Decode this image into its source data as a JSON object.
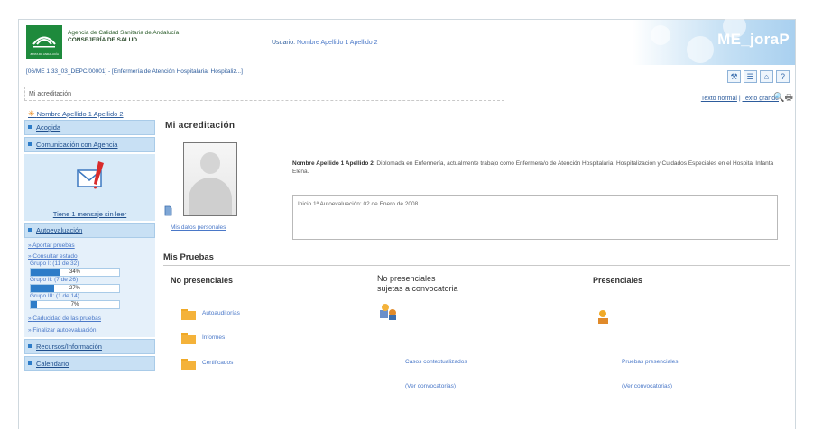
{
  "header": {
    "org_line1": "Agencia de Calidad Sanitaria de Andalucía",
    "org_line2": "CONSEJERÍA DE SALUD",
    "logo_caption": "JUNTA DE ANDALUCÍA",
    "user_prefix": "Usuario:",
    "user_name": "Nombre Apellido 1 Apellido 2",
    "brand": "ME_joraP",
    "breadcrumb": "[06/ME 1 33_03_DEPC/00001] - [Enfermería de Atención Hospitalaria: Hospitaliz...]"
  },
  "toolbar": {
    "icons": [
      "tools-icon",
      "list-icon",
      "home-icon",
      "question-icon"
    ],
    "icon_glyphs": [
      "⚒",
      "☰",
      "⌂",
      "?"
    ]
  },
  "location_field": "Mi acreditación",
  "text_size": {
    "normal": "Texto normal",
    "separator": "|",
    "large": "Texto grande"
  },
  "sidebar": {
    "user_name": "Nombre Apellido 1 Apellido 2",
    "nav": {
      "acogida": "Acogida",
      "comunicacion": "Comunicación con Agencia",
      "autoevaluacion": "Autoevaluación",
      "recursos": "Recursos/Información",
      "calendario": "Calendario"
    },
    "message": "Tiene 1 mensaje sin leer",
    "links": {
      "aportar": "Aportar pruebas",
      "consultar": "Consultar estado",
      "caducidad": "Caducidad de las pruebas",
      "finalizar": "Finalizar autoevaluación"
    },
    "groups": [
      {
        "label": "Grupo I: (11 de 32)",
        "percent_text": "34%",
        "fraction": 0.34
      },
      {
        "label": "Grupo II: (7 de 26)",
        "percent_text": "27%",
        "fraction": 0.27
      },
      {
        "label": "Grupo III: (1 de 14)",
        "percent_text": "7%",
        "fraction": 0.07
      }
    ]
  },
  "main": {
    "title": "Mi acreditación",
    "personal_link": "Mis datos personales",
    "desc_name": "Nombre Apellido 1 Apellido 2",
    "desc_text": ": Diplomada en Enfermería, actualmente trabajo como Enfermera/o de Atención Hospitalaria: Hospitalización y Cuidados Especiales en el Hospital Infanta Elena.",
    "start_info": "Inicio 1ª Autoevaluación: 02 de Enero de 2008",
    "section_title": "Mis Pruebas",
    "col1": {
      "title": "No presenciales",
      "items": [
        "Autoauditorías",
        "Informes",
        "Certificados"
      ]
    },
    "col2": {
      "title_line1": "No presenciales",
      "title_line2": "sujetas a convocatoria",
      "link1": "Casos contextualizados",
      "link2": "(Ver convocatorias)"
    },
    "col3": {
      "title": "Presenciales",
      "link1": "Pruebas presenciales",
      "link2": "(Ver convocatorias)"
    }
  }
}
